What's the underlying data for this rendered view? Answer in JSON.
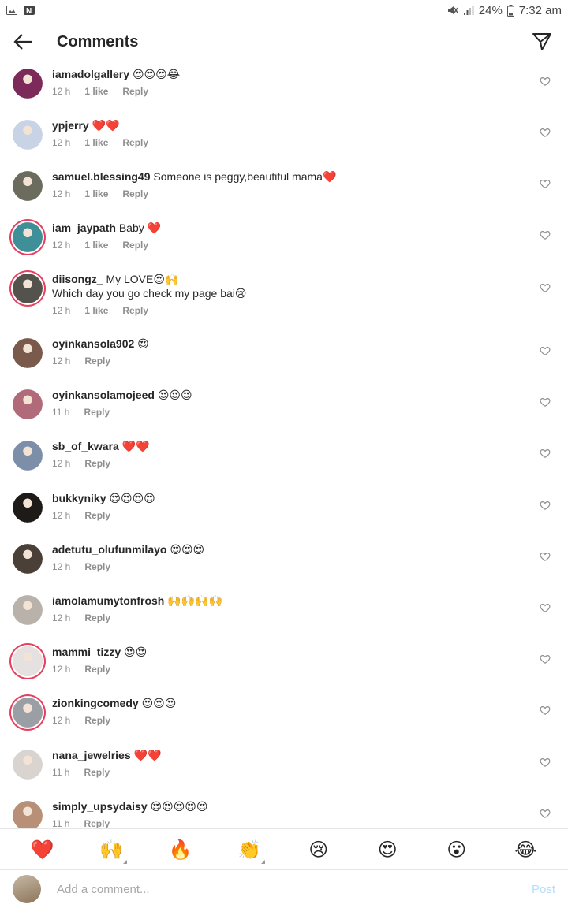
{
  "status_bar": {
    "battery": "24%",
    "time": "7:32 am"
  },
  "header": {
    "title": "Comments"
  },
  "comments": [
    {
      "user": "iamadolgallery",
      "text": "😍😍😍😂",
      "text2": "",
      "time": "12 h",
      "likes": "1 like",
      "reply": "Reply",
      "ring": false,
      "avatar_color": "#7b2a5a"
    },
    {
      "user": "ypjerry",
      "text": "❤️❤️",
      "text2": "",
      "time": "12 h",
      "likes": "1 like",
      "reply": "Reply",
      "ring": false,
      "avatar_color": "#c8d3e6"
    },
    {
      "user": "samuel.blessing49",
      "text": "Someone is peggy,beautiful mama❤️",
      "text2": "",
      "time": "12 h",
      "likes": "1 like",
      "reply": "Reply",
      "ring": false,
      "avatar_color": "#6b6b5e"
    },
    {
      "user": "iam_jaypath",
      "text": "Baby ❤️",
      "text2": "",
      "time": "12 h",
      "likes": "1 like",
      "reply": "Reply",
      "ring": true,
      "avatar_color": "#3e8f97"
    },
    {
      "user": "diisongz_",
      "text": "My LOVE😍🙌",
      "text2": "Which day you go check my page bai😢",
      "time": "12 h",
      "likes": "1 like",
      "reply": "Reply",
      "ring": true,
      "avatar_color": "#54524c"
    },
    {
      "user": "oyinkansola902",
      "text": "😍",
      "text2": "",
      "time": "12 h",
      "likes": "",
      "reply": "Reply",
      "ring": false,
      "avatar_color": "#7a5a4a"
    },
    {
      "user": "oyinkansolamojeed",
      "text": "😍😍😍",
      "text2": "",
      "time": "11 h",
      "likes": "",
      "reply": "Reply",
      "ring": false,
      "avatar_color": "#b06a79"
    },
    {
      "user": "sb_of_kwara",
      "text": "❤️❤️",
      "text2": "",
      "time": "12 h",
      "likes": "",
      "reply": "Reply",
      "ring": false,
      "avatar_color": "#7d8fa8"
    },
    {
      "user": "bukkyniky",
      "text": "😍😍😍😍",
      "text2": "",
      "time": "12 h",
      "likes": "",
      "reply": "Reply",
      "ring": false,
      "avatar_color": "#1e1a18"
    },
    {
      "user": "adetutu_olufunmilayo",
      "text": "😍😍😍",
      "text2": "",
      "time": "12 h",
      "likes": "",
      "reply": "Reply",
      "ring": false,
      "avatar_color": "#4a4038"
    },
    {
      "user": "iamolamumytonfrosh",
      "text": "🙌🙌🙌🙌",
      "text2": "",
      "time": "12 h",
      "likes": "",
      "reply": "Reply",
      "ring": false,
      "avatar_color": "#b9b2aa"
    },
    {
      "user": "mammi_tizzy",
      "text": "😍😍",
      "text2": "",
      "time": "12 h",
      "likes": "",
      "reply": "Reply",
      "ring": true,
      "avatar_color": "#e5e1e0"
    },
    {
      "user": "zionkingcomedy",
      "text": "😍😍😍",
      "text2": "",
      "time": "12 h",
      "likes": "",
      "reply": "Reply",
      "ring": true,
      "avatar_color": "#9a9fa6"
    },
    {
      "user": "nana_jewelries",
      "text": "❤️❤️",
      "text2": "",
      "time": "11 h",
      "likes": "",
      "reply": "Reply",
      "ring": false,
      "avatar_color": "#d9d4cf"
    },
    {
      "user": "simply_upsydaisy",
      "text": "😍😍😍😍😍",
      "text2": "",
      "time": "11 h",
      "likes": "",
      "reply": "Reply",
      "ring": false,
      "avatar_color": "#b89077"
    }
  ],
  "emoji_bar": [
    "❤️",
    "🙌",
    "🔥",
    "👏",
    "😢",
    "😍",
    "😮",
    "😂"
  ],
  "composer": {
    "placeholder": "Add a comment...",
    "post_label": "Post"
  },
  "colors": {
    "ring": "#e4405f",
    "meta": "#8e8e8e",
    "post_disabled": "#b2dffc"
  }
}
